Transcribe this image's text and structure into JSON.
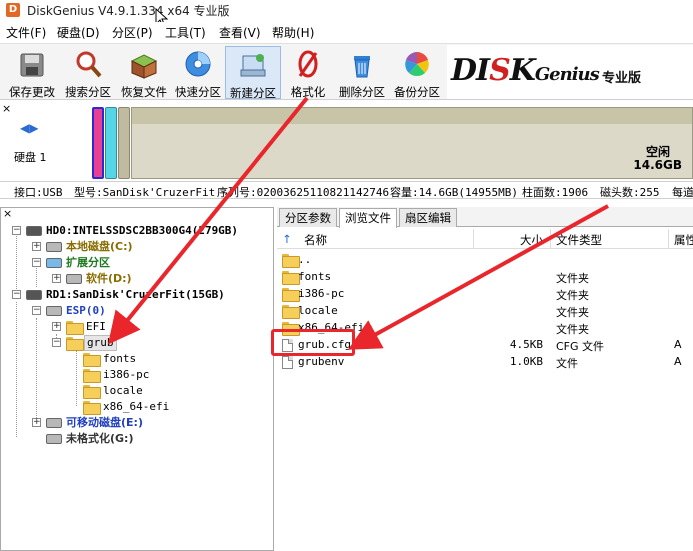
{
  "window": {
    "title": "DiskGenius V4.9.1.334 x64 专业版",
    "app_icon_letter": "D"
  },
  "menu": [
    "文件(F)",
    "硬盘(D)",
    "分区(P)",
    "工具(T)",
    "查看(V)",
    "帮助(H)"
  ],
  "toolbar": {
    "buttons": [
      {
        "label": "保存更改",
        "icon": "save-icon"
      },
      {
        "label": "搜索分区",
        "icon": "magnifier-icon"
      },
      {
        "label": "恢复文件",
        "icon": "recover-box-icon"
      },
      {
        "label": "快速分区",
        "icon": "disc-icon"
      },
      {
        "label": "新建分区",
        "icon": "new-partition-icon"
      },
      {
        "label": "格式化",
        "icon": "format-icon"
      },
      {
        "label": "删除分区",
        "icon": "trash-icon"
      },
      {
        "label": "备份分区",
        "icon": "color-wheel-icon"
      }
    ],
    "active_index": 4
  },
  "brand": {
    "logo_prefix": "DI",
    "logo_mid": "S",
    "logo_suffix": "K",
    "logo_genius": "Genius",
    "edition": "专业版"
  },
  "disk_bar": {
    "close_glyph": "×",
    "nav_left": "◀",
    "nav_right": "▶",
    "disk_label": "硬盘 1",
    "free_label": "空闲",
    "free_size": "14.6GB"
  },
  "disk_info": {
    "interface": "接口:USB",
    "model": "型号:SanDisk'CruzerFit",
    "serial": "序列号:02003625110821142746",
    "capacity": "容量:14.6GB(14955MB)",
    "cylinders": "柱面数:1906",
    "heads": "磁头数:255",
    "sectors_partial": "每道"
  },
  "tree": {
    "close_glyph": "×",
    "nodes": [
      {
        "text": "HD0:INTELSSDSC2BB300G4(279GB)",
        "color": "#000000"
      },
      {
        "text": "本地磁盘(C:)",
        "color": "#8a6d00"
      },
      {
        "text": "扩展分区",
        "color": "#1d7a1d"
      },
      {
        "text": "软件(D:)",
        "color": "#8a6d00"
      },
      {
        "text": "RD1:SanDisk'CruzerFit(15GB)",
        "color": "#000000"
      },
      {
        "text": "ESP(0)",
        "color": "#1f3fbf"
      },
      {
        "text": "EFI",
        "color": "#000000"
      },
      {
        "text": "grub",
        "color": "#000000"
      },
      {
        "text": "fonts",
        "color": "#000000"
      },
      {
        "text": "i386-pc",
        "color": "#000000"
      },
      {
        "text": "locale",
        "color": "#000000"
      },
      {
        "text": "x86_64-efi",
        "color": "#000000"
      },
      {
        "text": "可移动磁盘(E:)",
        "color": "#1f3fbf"
      },
      {
        "text": "未格式化(G:)",
        "color": "#333333"
      }
    ]
  },
  "tabs": [
    "分区参数",
    "浏览文件",
    "扇区编辑"
  ],
  "active_tab": 1,
  "file_list": {
    "up_glyph": "↑",
    "columns": {
      "name": "名称",
      "size": "大小",
      "type": "文件类型",
      "attr": "属性"
    },
    "rows": [
      {
        "name": "..",
        "size": "",
        "type": "",
        "attr": "",
        "kind": "folder"
      },
      {
        "name": "fonts",
        "size": "",
        "type": "文件夹",
        "attr": "",
        "kind": "folder"
      },
      {
        "name": "i386-pc",
        "size": "",
        "type": "文件夹",
        "attr": "",
        "kind": "folder"
      },
      {
        "name": "locale",
        "size": "",
        "type": "文件夹",
        "attr": "",
        "kind": "folder"
      },
      {
        "name": "x86_64-efi",
        "size": "",
        "type": "文件夹",
        "attr": "",
        "kind": "folder"
      },
      {
        "name": "grub.cfg",
        "size": "4.5KB",
        "type": "CFG 文件",
        "attr": "A",
        "kind": "file"
      },
      {
        "name": "grubenv",
        "size": "1.0KB",
        "type": "文件",
        "attr": "A",
        "kind": "file"
      }
    ]
  },
  "colors": {
    "annotation": "#e8262b",
    "active_tool": "#dbe8f7",
    "free_space": "#ddd9c8"
  }
}
